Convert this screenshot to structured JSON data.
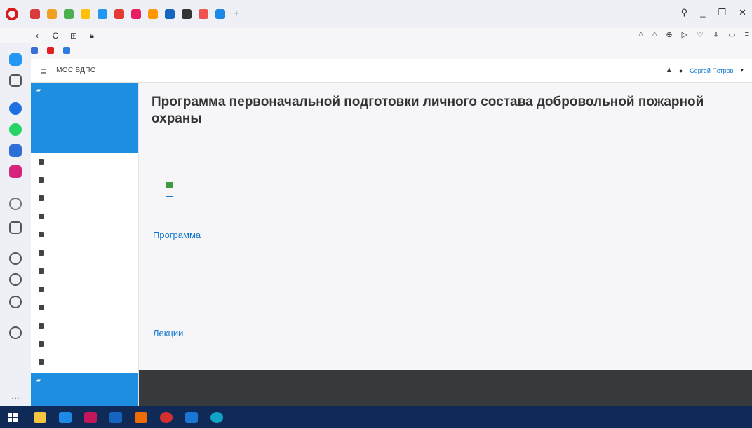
{
  "browser": {
    "new_tab_label": "+",
    "window_controls": [
      "⚲",
      "_",
      "❐",
      "✕"
    ],
    "address_bar": {
      "back": "‹",
      "reload": "C",
      "url": ""
    },
    "address_right_icons": [
      "⌂",
      "⌂",
      "⊕",
      "▷",
      "♡",
      "⇩",
      "▭",
      "≡"
    ],
    "bookmarks": [
      {
        "label": "",
        "icon": "page-icon",
        "color": "#3a6fd8"
      },
      {
        "label": "",
        "icon": "yandex-icon",
        "color": "#e02020"
      },
      {
        "label": "",
        "icon": "page-icon",
        "color": "#2f7be0"
      }
    ]
  },
  "moodle": {
    "site_name": "MOC ВДПО",
    "user": {
      "name": "Сергей Петров",
      "icons": [
        "bell-icon",
        "chat-icon"
      ]
    },
    "drawer": {
      "active_course": "",
      "items": [
        {
          "label": "",
          "icon": "participants-icon"
        },
        {
          "label": "",
          "icon": "badge-icon"
        },
        {
          "label": "",
          "icon": "competency-icon"
        },
        {
          "label": "",
          "icon": "grades-icon"
        },
        {
          "label": "",
          "icon": "folder-icon"
        },
        {
          "label": "",
          "icon": "folder-icon"
        },
        {
          "label": "",
          "icon": "folder-icon"
        },
        {
          "label": "",
          "icon": "dashboard-icon"
        },
        {
          "label": "",
          "icon": "home-icon"
        },
        {
          "label": "",
          "icon": "calendar-icon"
        },
        {
          "label": "",
          "icon": "file-icon"
        },
        {
          "label": "",
          "icon": "courses-icon"
        }
      ],
      "next_active_course": ""
    },
    "main": {
      "title": "Программа первоначальной подготовки личного состава добровольной пожарной охраны",
      "breadcrumb": "",
      "resources": [
        {
          "label": "",
          "icon": "plan-icon"
        },
        {
          "label": "",
          "icon": "list-icon"
        }
      ],
      "sections": [
        {
          "title": "Программа",
          "description": "",
          "meta": [
            "",
            ""
          ]
        },
        {
          "title": "Лекции",
          "meta": [
            ""
          ]
        }
      ]
    },
    "footer": {
      "links": [
        "",
        "",
        "",
        ""
      ]
    }
  },
  "taskbar": {
    "apps": [
      "explorer",
      "app2",
      "app3",
      "app4",
      "app5",
      "opera",
      "mail",
      "edge"
    ],
    "tray": ""
  }
}
